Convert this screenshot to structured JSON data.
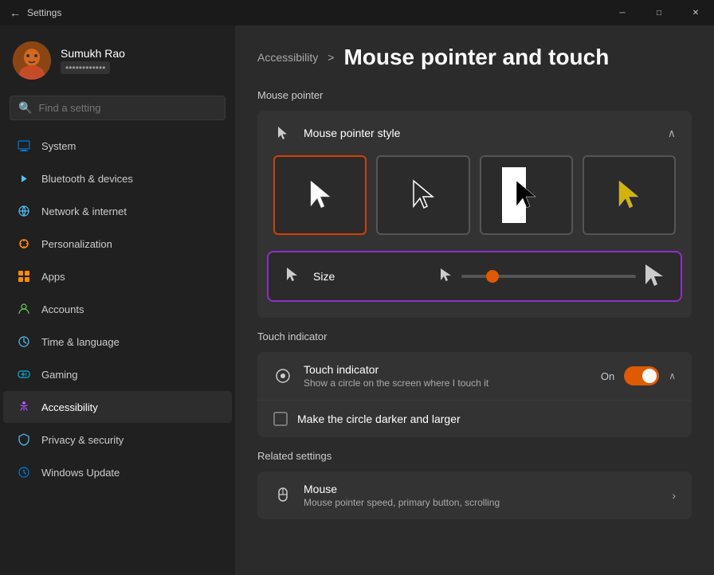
{
  "titlebar": {
    "title": "Settings",
    "back_icon": "←",
    "minimize": "─",
    "maximize": "□",
    "close": "✕"
  },
  "user": {
    "name": "Sumukh Rao",
    "email": "••••••••••••",
    "avatar_emoji": "👤"
  },
  "search": {
    "placeholder": "Find a setting"
  },
  "nav": {
    "items": [
      {
        "id": "system",
        "label": "System",
        "color": "#0078d4"
      },
      {
        "id": "bluetooth",
        "label": "Bluetooth & devices",
        "color": "#4fc3f7"
      },
      {
        "id": "network",
        "label": "Network & internet",
        "color": "#4fc3f7"
      },
      {
        "id": "personalization",
        "label": "Personalization",
        "color": "#ff8c00"
      },
      {
        "id": "apps",
        "label": "Apps",
        "color": "#ff8c00"
      },
      {
        "id": "accounts",
        "label": "Accounts",
        "color": "#6ccb5f"
      },
      {
        "id": "time",
        "label": "Time & language",
        "color": "#4fc3f7"
      },
      {
        "id": "gaming",
        "label": "Gaming",
        "color": "#00b4d8"
      },
      {
        "id": "accessibility",
        "label": "Accessibility",
        "color": "#a855f7"
      },
      {
        "id": "privacy",
        "label": "Privacy & security",
        "color": "#4fc3f7"
      },
      {
        "id": "windows",
        "label": "Windows Update",
        "color": "#0078d4"
      }
    ]
  },
  "breadcrumb": {
    "parent": "Accessibility",
    "arrow": ">",
    "current": "Mouse pointer and touch"
  },
  "mouse_pointer": {
    "section_title": "Mouse pointer",
    "style_label": "Mouse pointer style",
    "options": [
      {
        "id": "white",
        "selected": true
      },
      {
        "id": "outline",
        "selected": false
      },
      {
        "id": "invert",
        "selected": false
      },
      {
        "id": "yellow",
        "selected": false
      }
    ],
    "size_label": "Size",
    "slider_value": 18
  },
  "touch_indicator": {
    "section_title": "Touch indicator",
    "title": "Touch indicator",
    "subtitle": "Show a circle on the screen where I touch it",
    "toggle_state": "On",
    "checkbox_label": "Make the circle darker and larger",
    "checkbox_checked": false
  },
  "related_settings": {
    "section_title": "Related settings",
    "items": [
      {
        "id": "mouse",
        "title": "Mouse",
        "subtitle": "Mouse pointer speed, primary button, scrolling"
      }
    ]
  }
}
